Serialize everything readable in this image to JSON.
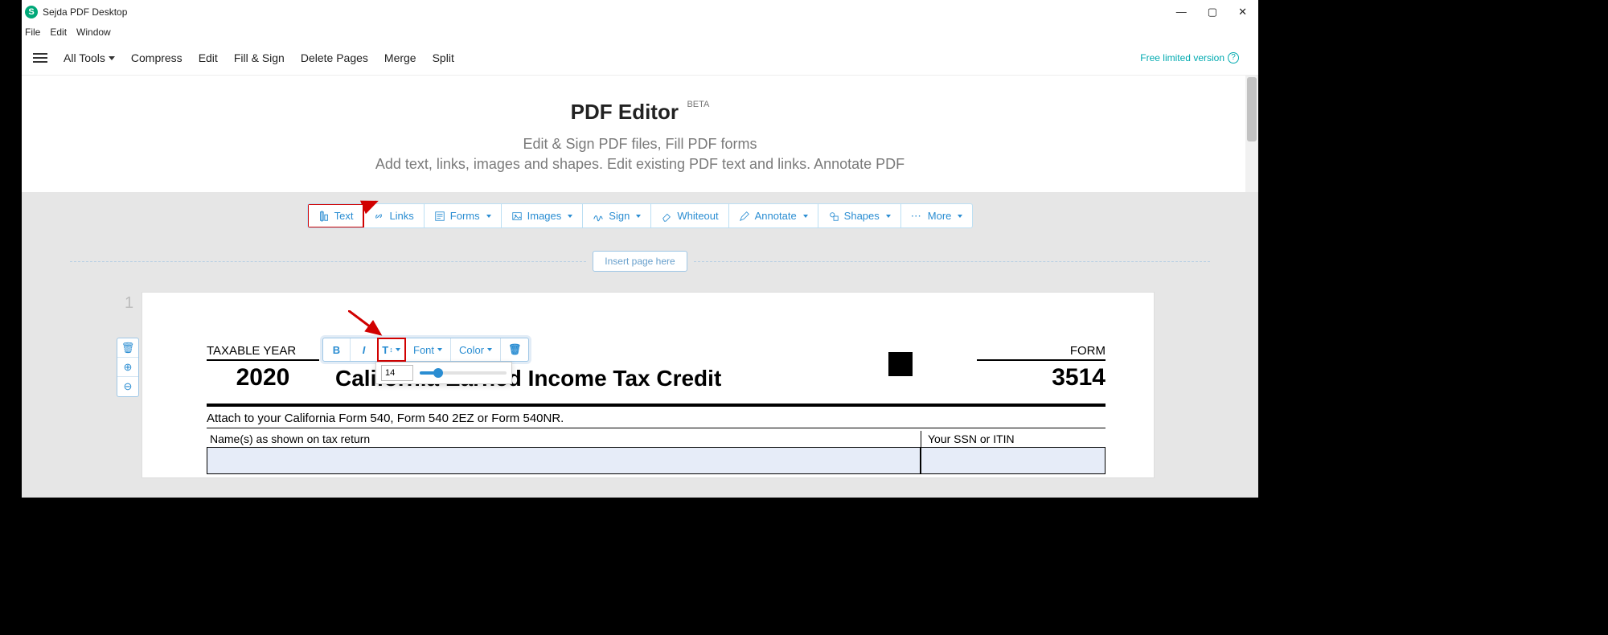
{
  "window": {
    "title": "Sejda PDF Desktop"
  },
  "menubar": {
    "file": "File",
    "edit": "Edit",
    "window": "Window"
  },
  "apptoolbar": {
    "all_tools": "All Tools",
    "compress": "Compress",
    "edit": "Edit",
    "fill_sign": "Fill & Sign",
    "delete_pages": "Delete Pages",
    "merge": "Merge",
    "split": "Split",
    "free_label": "Free limited version"
  },
  "header": {
    "title": "PDF Editor",
    "beta": "BETA",
    "subtitle": "Edit & Sign PDF files, Fill PDF forms",
    "description": "Add text, links, images and shapes. Edit existing PDF text and links. Annotate PDF"
  },
  "ribbon": {
    "text": "Text",
    "links": "Links",
    "forms": "Forms",
    "images": "Images",
    "sign": "Sign",
    "whiteout": "Whiteout",
    "annotate": "Annotate",
    "shapes": "Shapes",
    "more": "More"
  },
  "insert_page": "Insert page here",
  "page_number": "1",
  "form": {
    "taxable_year_label": "TAXABLE YEAR",
    "year": "2020",
    "title": "California Earned Income Tax Credit",
    "form_label": "FORM",
    "form_no": "3514",
    "attach": "Attach to your California Form 540, Form 540 2EZ or Form 540NR.",
    "names_label": "Name(s) as shown on tax return",
    "ssn_label": "Your SSN or ITIN"
  },
  "floatbar": {
    "bold": "B",
    "italic": "I",
    "size_icon": "T",
    "font": "Font",
    "color": "Color"
  },
  "fontsize": {
    "value": "14"
  }
}
